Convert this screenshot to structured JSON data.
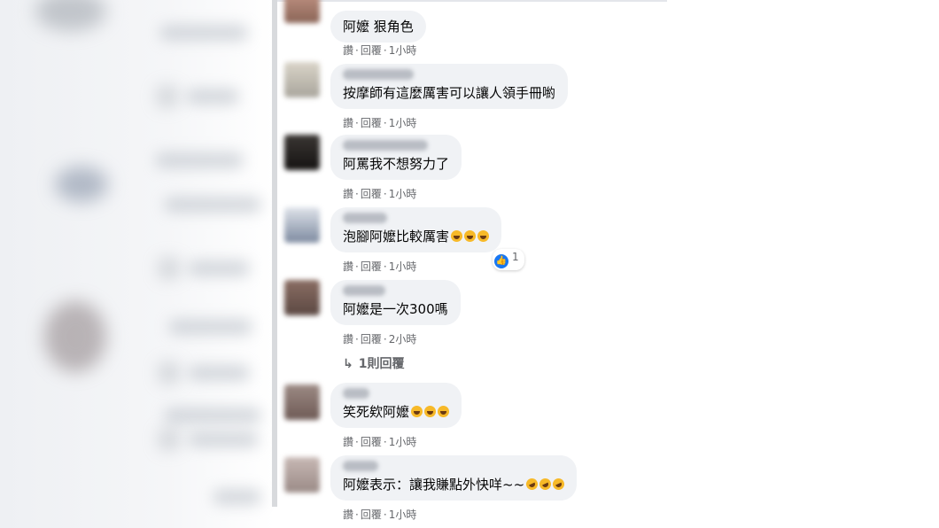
{
  "comments": [
    {
      "text": "阿嬤 狠角色",
      "actions": [
        "讚",
        "回覆",
        "1小時"
      ],
      "emojis": []
    },
    {
      "text": "按摩師有這麼厲害可以讓人領手冊喲",
      "actions": [
        "讚",
        "回覆",
        "1小時"
      ],
      "emojis": []
    },
    {
      "text": "阿罵我不想努力了",
      "actions": [
        "讚",
        "回覆",
        "1小時"
      ],
      "emojis": []
    },
    {
      "text": "泡腳阿嬤比較厲害",
      "actions": [
        "讚",
        "回覆",
        "1小時"
      ],
      "emojis": [
        "laugh-cry-emoji",
        "laugh-cry-emoji",
        "laugh-cry-emoji"
      ],
      "reaction_count": "1"
    },
    {
      "text": "阿嬤是一次300嗎",
      "actions": [
        "讚",
        "回覆",
        "2小時"
      ],
      "emojis": [],
      "replies_label": "1則回覆"
    },
    {
      "text": "笑死欸阿嬤",
      "actions": [
        "讚",
        "回覆",
        "1小時"
      ],
      "emojis": [
        "grin-emoji",
        "grin-emoji",
        "grin-emoji"
      ]
    },
    {
      "text": "阿嬤表示：讓我賺點外快咩~~",
      "actions": [
        "讚",
        "回覆",
        "1小時"
      ],
      "emojis": [
        "rofl-emoji",
        "rofl-emoji",
        "rofl-emoji"
      ]
    }
  ],
  "separator": "·",
  "colors": {
    "bubble": "#f0f2f5",
    "meta": "#65676b",
    "like": "#1877f2"
  }
}
